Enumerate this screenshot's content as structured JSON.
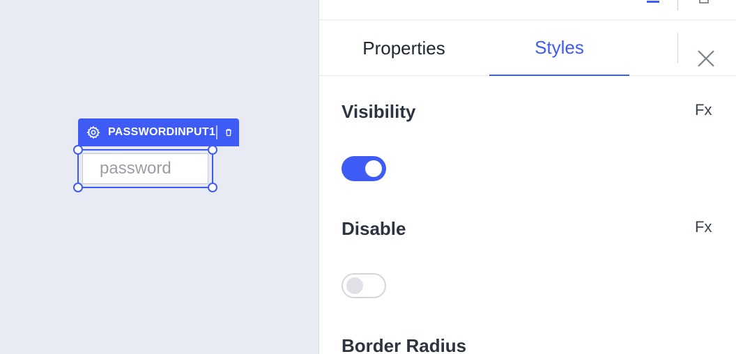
{
  "canvas": {
    "widget_tag_label": "PASSWORDINPUT1",
    "input_placeholder": "password"
  },
  "pane": {
    "tabs": [
      {
        "label": "Properties",
        "active": false
      },
      {
        "label": "Styles",
        "active": true
      }
    ],
    "sections": {
      "visibility": {
        "title": "Visibility",
        "fx": "Fx",
        "enabled": true
      },
      "disable": {
        "title": "Disable",
        "fx": "Fx",
        "enabled": false
      },
      "border_radius": {
        "title": "Border Radius"
      }
    }
  },
  "colors": {
    "accent": "#3e5bf5",
    "canvas_bg": "#e8ebf4",
    "text_dark": "#2b3440"
  },
  "icons": [
    "gear-icon",
    "trash-icon",
    "close-icon"
  ]
}
